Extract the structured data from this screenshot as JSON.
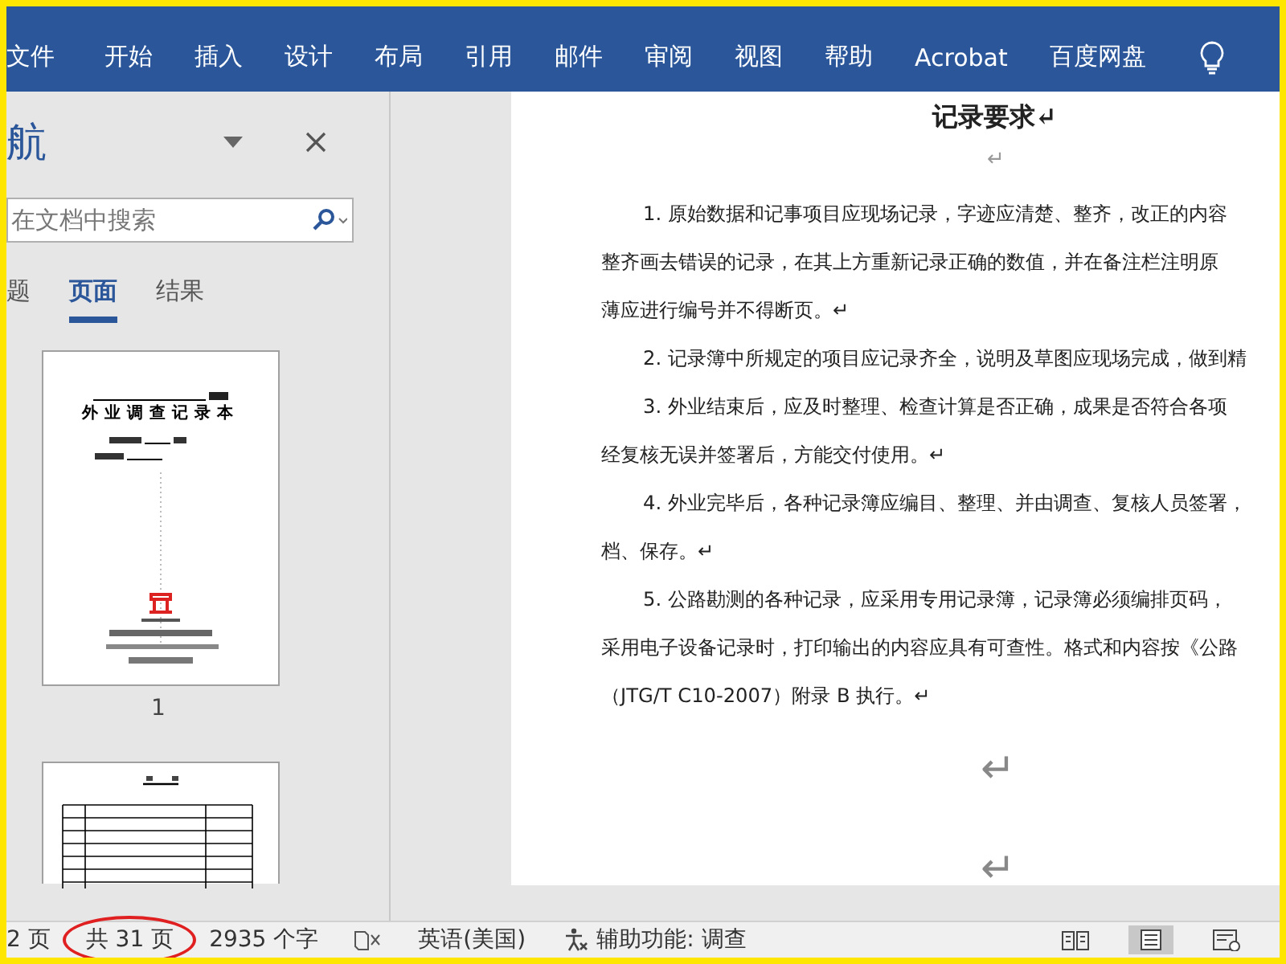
{
  "ribbon": {
    "tabs": [
      {
        "label": "文件",
        "selected": false
      },
      {
        "label": "开始",
        "selected": false
      },
      {
        "label": "插入",
        "selected": false
      },
      {
        "label": "设计",
        "selected": false
      },
      {
        "label": "布局",
        "selected": false
      },
      {
        "label": "引用",
        "selected": false
      },
      {
        "label": "邮件",
        "selected": false
      },
      {
        "label": "审阅",
        "selected": false
      },
      {
        "label": "视图",
        "selected": false
      },
      {
        "label": "帮助",
        "selected": false
      },
      {
        "label": "Acrobat",
        "selected": false
      },
      {
        "label": "百度网盘",
        "selected": false
      }
    ]
  },
  "navigation": {
    "title": "航",
    "search": {
      "placeholder": "在文档中搜索"
    },
    "tabs": [
      {
        "label": "题",
        "selected": false
      },
      {
        "label": "页面",
        "selected": true
      },
      {
        "label": "结果",
        "selected": false
      }
    ],
    "thumbnails": [
      {
        "kind": "cover",
        "title": "外业调查记录本",
        "page_number": "1"
      },
      {
        "kind": "table"
      }
    ]
  },
  "document": {
    "title": "记录要求↵",
    "blank_mark": "↵",
    "lines": [
      {
        "text": "1. 原始数据和记事项目应现场记录，字迹应清楚、整齐，改正的内容",
        "indent": true
      },
      {
        "text": "整齐画去错误的记录，在其上方重新记录正确的数值，并在备注栏注明原",
        "indent": false
      },
      {
        "text": "薄应进行编号并不得断页。↵",
        "indent": false
      },
      {
        "text": "2. 记录簿中所规定的项目应记录齐全，说明及草图应现场完成，做到精",
        "indent": true
      },
      {
        "text": "3. 外业结束后，应及时整理、检查计算是否正确，成果是否符合各项",
        "indent": true
      },
      {
        "text": "经复核无误并签署后，方能交付使用。↵",
        "indent": false
      },
      {
        "text": "4. 外业完毕后，各种记录簿应编目、整理、并由调查、复核人员签署，",
        "indent": true
      },
      {
        "text": "档、保存。↵",
        "indent": false
      },
      {
        "text": "5. 公路勘测的各种记录，应采用专用记录簿，记录簿必须编排页码，",
        "indent": true
      },
      {
        "text": "采用电子设备记录时，打印输出的内容应具有可查性。格式和内容按《公路",
        "indent": false
      },
      {
        "text": "（JTG/T C10-2007）附录 B 执行。↵",
        "indent": false
      }
    ],
    "trailing_marks": [
      "↵",
      "↵"
    ]
  },
  "status_bar": {
    "items": [
      {
        "kind": "text",
        "text": "2 页",
        "circled": false
      },
      {
        "kind": "text",
        "text": "共 31 页",
        "circled": true
      },
      {
        "kind": "text",
        "text": "2935 个字",
        "circled": false
      },
      {
        "kind": "proofing"
      },
      {
        "kind": "text",
        "text": "英语(美国)",
        "circled": false
      },
      {
        "kind": "accessibility",
        "text": "辅助功能: 调查"
      }
    ],
    "views": [
      {
        "kind": "read",
        "selected": false
      },
      {
        "kind": "print",
        "selected": true
      },
      {
        "kind": "web",
        "selected": false
      }
    ]
  }
}
